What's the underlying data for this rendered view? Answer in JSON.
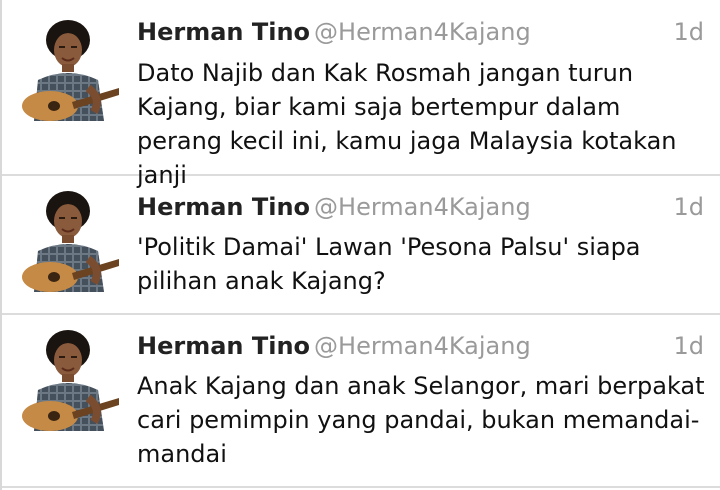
{
  "tweets": [
    {
      "name": "Herman Tino",
      "handle": "@Herman4Kajang",
      "time": "1d",
      "text": "Dato Najib dan Kak Rosmah jangan turun Kajang, biar kami saja bertempur dalam perang kecil ini, kamu jaga Malaysia kotakan janji"
    },
    {
      "name": "Herman Tino",
      "handle": "@Herman4Kajang",
      "time": "1d",
      "text": "'Politik Damai' Lawan 'Pesona Palsu' siapa pilihan anak Kajang?"
    },
    {
      "name": "Herman Tino",
      "handle": "@Herman4Kajang",
      "time": "1d",
      "text": "Anak Kajang dan anak Selangor, mari berpakat cari pemimpin yang pandai, bukan memandai-mandai"
    }
  ],
  "colors": {
    "name": "#222222",
    "secondary": "#9a9a9a",
    "divider": "#dcdcdc"
  },
  "icons": {
    "avatar": "avatar-man-with-guitar"
  }
}
